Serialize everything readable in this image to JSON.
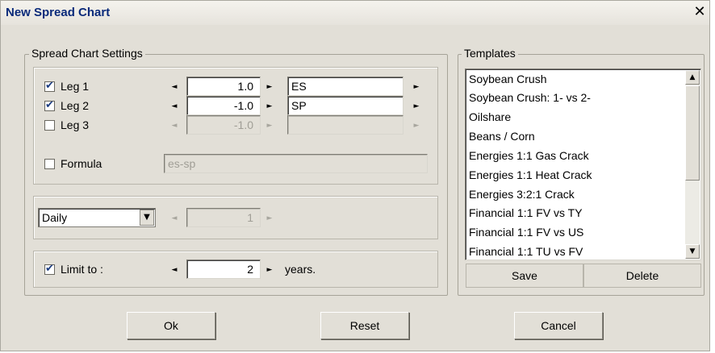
{
  "window": {
    "title": "New Spread Chart",
    "close_glyph": "✕"
  },
  "settings": {
    "group_label": "Spread Chart Settings",
    "legs": [
      {
        "label": "Leg 1",
        "checked": true,
        "value": "1.0",
        "symbol": "ES",
        "enabled": true
      },
      {
        "label": "Leg 2",
        "checked": true,
        "value": "-1.0",
        "symbol": "SP",
        "enabled": true
      },
      {
        "label": "Leg 3",
        "checked": false,
        "value": "-1.0",
        "symbol": "",
        "enabled": false
      }
    ],
    "formula": {
      "label": "Formula",
      "checked": false,
      "value": "es-sp"
    },
    "period": {
      "selected": "Daily",
      "interval": "1"
    },
    "limit": {
      "label": "Limit to :",
      "checked": true,
      "value": "2",
      "unit": "years."
    }
  },
  "templates": {
    "group_label": "Templates",
    "items": [
      "Soybean Crush",
      "Soybean Crush: 1- vs 2-",
      "Oilshare",
      "Beans / Corn",
      "Energies 1:1 Gas Crack",
      "Energies 1:1 Heat Crack",
      "Energies 3:2:1 Crack",
      "Financial 1:1 FV vs TY",
      "Financial 1:1 FV vs US",
      "Financial 1:1 TU vs FV"
    ],
    "save_label": "Save",
    "delete_label": "Delete"
  },
  "footer": {
    "ok_label": "Ok",
    "reset_label": "Reset",
    "cancel_label": "Cancel"
  },
  "icons": {
    "left_arrow": "◄",
    "right_arrow": "►",
    "check": "✔",
    "dropdown": "▼",
    "scroll_up": "▲",
    "scroll_down": "▼"
  }
}
